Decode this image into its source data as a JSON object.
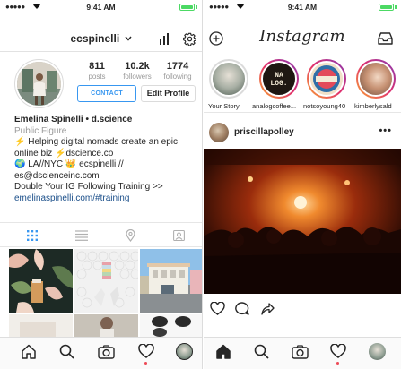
{
  "left_phone": {
    "status": {
      "signal": "●●●●●",
      "time": "9:41 AM"
    },
    "header": {
      "username": "ecspinelli",
      "chevron": "chevron-down-icon",
      "icons": [
        "insights-icon",
        "gear-icon"
      ]
    },
    "stats": [
      {
        "value": "811",
        "label": "posts"
      },
      {
        "value": "10.2k",
        "label": "followers"
      },
      {
        "value": "1774",
        "label": "following"
      }
    ],
    "buttons": {
      "contact": "CONTACT",
      "edit": "Edit Profile"
    },
    "bio": {
      "name": "Emelina Spinelli • d.science",
      "category": "Public Figure",
      "line1": "⚡ Helping digital nomads create an epic",
      "line2": "online biz ⚡dscience.co",
      "line3": "🌍 LA//NYC 👑 ecspinelli //",
      "line4": "es@dscienceinc.com",
      "line5": "Double Your IG Following Training >>",
      "link": "emelinaspinelli.com/#training"
    },
    "tabs": [
      "grid-icon",
      "list-icon",
      "location-pin-icon",
      "tagged-icon"
    ],
    "bottom_nav": [
      "home-icon",
      "search-icon",
      "camera-icon",
      "heart-icon",
      "profile-avatar"
    ]
  },
  "right_phone": {
    "status": {
      "signal": "●●●●●",
      "time": "9:41 AM"
    },
    "header": {
      "logo": "Instagram",
      "icons": [
        "add-story-icon",
        "inbox-icon"
      ]
    },
    "stories": [
      {
        "label": "Your Story"
      },
      {
        "label": "analogcoffee..."
      },
      {
        "label": "notsoyoung40"
      },
      {
        "label": "kimberlysald"
      }
    ],
    "story_badge": "NA LOG.",
    "post": {
      "username": "priscillapolley",
      "more": "•••"
    },
    "actions": [
      "heart-icon",
      "comment-icon",
      "share-icon"
    ],
    "bottom_nav": [
      "home-icon",
      "search-icon",
      "camera-icon",
      "heart-icon",
      "profile-avatar"
    ]
  },
  "colors": {
    "accent": "#3897f0",
    "text": "#262626",
    "muted": "#999999",
    "link": "#1b4f8a",
    "notification": "#ed4956",
    "battery": "#4cd964"
  }
}
